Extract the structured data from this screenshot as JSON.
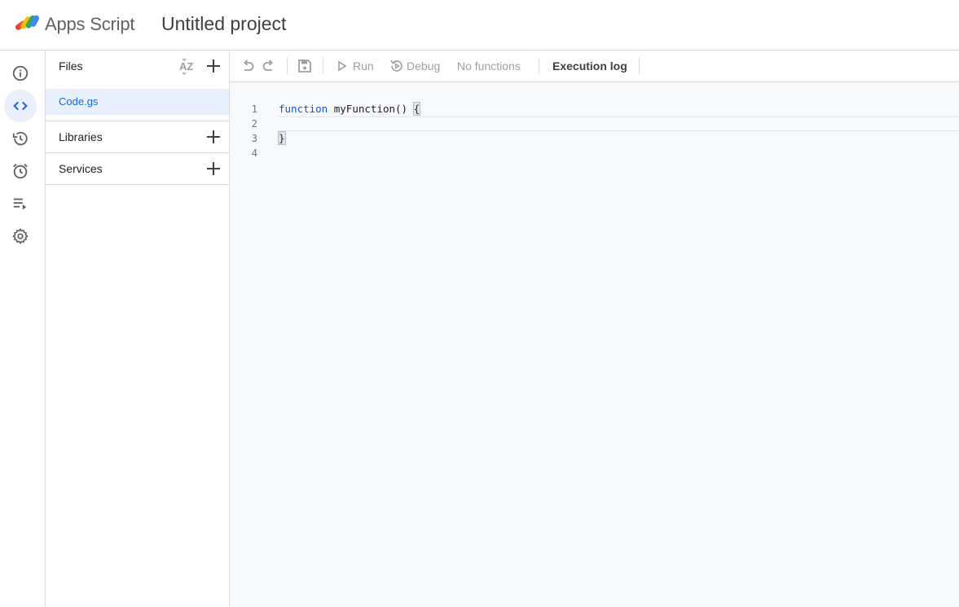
{
  "header": {
    "app_name": "Apps Script",
    "project_title": "Untitled project"
  },
  "rail": {
    "items": [
      {
        "name": "overview",
        "icon": "info-icon"
      },
      {
        "name": "editor",
        "icon": "code-icon",
        "active": true
      },
      {
        "name": "project-history",
        "icon": "history-icon"
      },
      {
        "name": "triggers",
        "icon": "alarm-clock-icon"
      },
      {
        "name": "executions",
        "icon": "playlist-play-icon"
      },
      {
        "name": "project-settings",
        "icon": "gear-icon"
      }
    ]
  },
  "files_panel": {
    "files_label": "Files",
    "files": [
      "Code.gs"
    ],
    "libraries_label": "Libraries",
    "services_label": "Services"
  },
  "toolbar": {
    "run_label": "Run",
    "debug_label": "Debug",
    "function_select": "No functions",
    "execution_log_label": "Execution log"
  },
  "editor": {
    "line_numbers": [
      "1",
      "2",
      "3",
      "4"
    ],
    "lines": [
      {
        "keyword": "function",
        "rest": " myFunction() ",
        "brace": "{"
      },
      {
        "keyword": "",
        "rest": "",
        "brace": ""
      },
      {
        "keyword": "",
        "rest": "",
        "brace": "}"
      },
      {
        "keyword": "",
        "rest": "",
        "brace": ""
      }
    ]
  },
  "colors": {
    "accent": "#1967d2",
    "active_bg": "#e8f0fe",
    "border": "#dadce0",
    "editor_bg": "#f8f9fa",
    "disabled_text": "#9aa0a6"
  }
}
